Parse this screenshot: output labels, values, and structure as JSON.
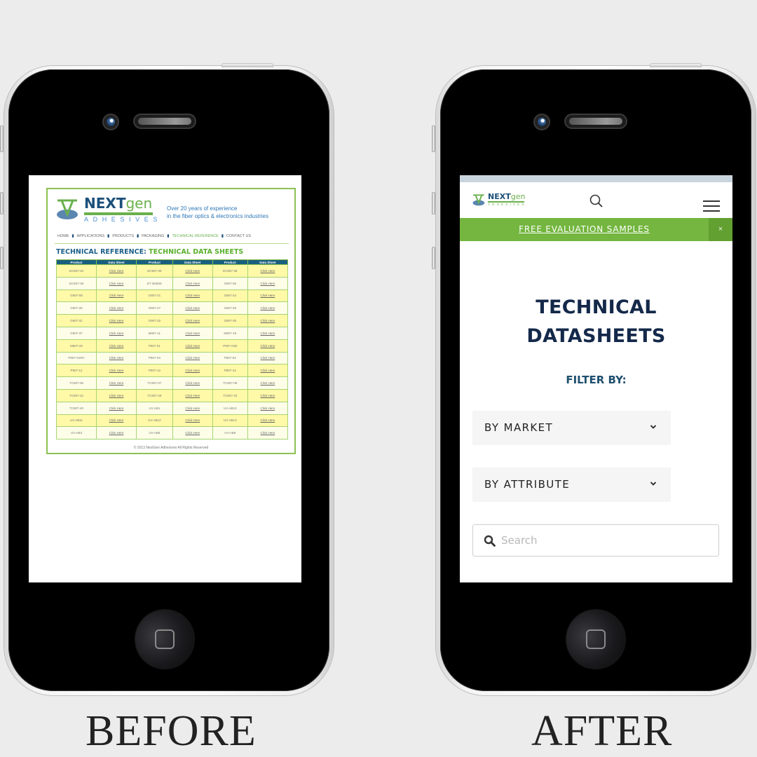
{
  "captions": {
    "before": "BEFORE",
    "after": "AFTER"
  },
  "before": {
    "logo": {
      "word_main": "NEXT",
      "word_accent": "gen",
      "sub": "ADHESIVES"
    },
    "tagline": [
      "Over 20 years of experience",
      "in the fiber optics & electronics industries"
    ],
    "nav": [
      {
        "label": "HOME",
        "active": false
      },
      {
        "label": "APPLICATIONS",
        "active": false
      },
      {
        "label": "PRODUCTS",
        "active": false
      },
      {
        "label": "PACKAGING",
        "active": false
      },
      {
        "label": "TECHNICAL REFERENCE",
        "active": true
      },
      {
        "label": "CONTACT US",
        "active": false
      }
    ],
    "heading": {
      "prefix": "TECHNICAL REFERENCE: ",
      "main": "TECHNICAL DATA SHEETS"
    },
    "table": {
      "headers": [
        "Product",
        "Data Sheet",
        "Product",
        "Data Sheet",
        "Product",
        "Data Sheet"
      ],
      "link_label": "Click Here",
      "rows": [
        [
          "EC907-34",
          "EC907-36",
          "EC907-38"
        ],
        [
          "EC907-39",
          "ET 353ND",
          "G907-05"
        ],
        [
          "G907-08",
          "G907-21",
          "G907-24"
        ],
        [
          "G907-25",
          "G907-27",
          "G907-28"
        ],
        [
          "G907-31",
          "G907-32",
          "G907-35"
        ],
        [
          "G907-37",
          "M907-11",
          "M907-19"
        ],
        [
          "M907-20",
          "P907-01",
          "P907-01B"
        ],
        [
          "P907-01RV",
          "P907-03",
          "P907-04"
        ],
        [
          "P907-12",
          "P907-13",
          "P907-44"
        ],
        [
          "TC907-06",
          "TC907-07",
          "TC907-09"
        ],
        [
          "TC907-22",
          "TC907-29",
          "TC907-33"
        ],
        [
          "TC907-40",
          "UV-AB1",
          "UV-AB10"
        ],
        [
          "UV-AB11",
          "UV-AB12",
          "UV-AB13"
        ],
        [
          "UV-AB3",
          "UV-AB6",
          "UV-AB9"
        ]
      ]
    },
    "footer": "© 2013 NextGen Adhesives All Rights Reserved"
  },
  "after": {
    "logo": {
      "word_main": "NEXT",
      "word_accent": "gen",
      "sub": "ADHESIVES"
    },
    "promo": {
      "label": "FREE EVALUATION SAMPLES",
      "close": "×"
    },
    "title_lines": [
      "TECHNICAL",
      "DATASHEETS"
    ],
    "filter_label": "FILTER BY:",
    "filters": [
      {
        "label": "BY MARKET"
      },
      {
        "label": "BY ATTRIBUTE"
      }
    ],
    "search": {
      "placeholder": "Search",
      "value": ""
    }
  },
  "colors": {
    "brand_blue": "#1b4f7a",
    "brand_green": "#6ab04c",
    "promo_green": "#74b63f",
    "title_navy": "#14294a",
    "table_header": "#1b5f7e",
    "row_yellow": "#fff9a8"
  }
}
